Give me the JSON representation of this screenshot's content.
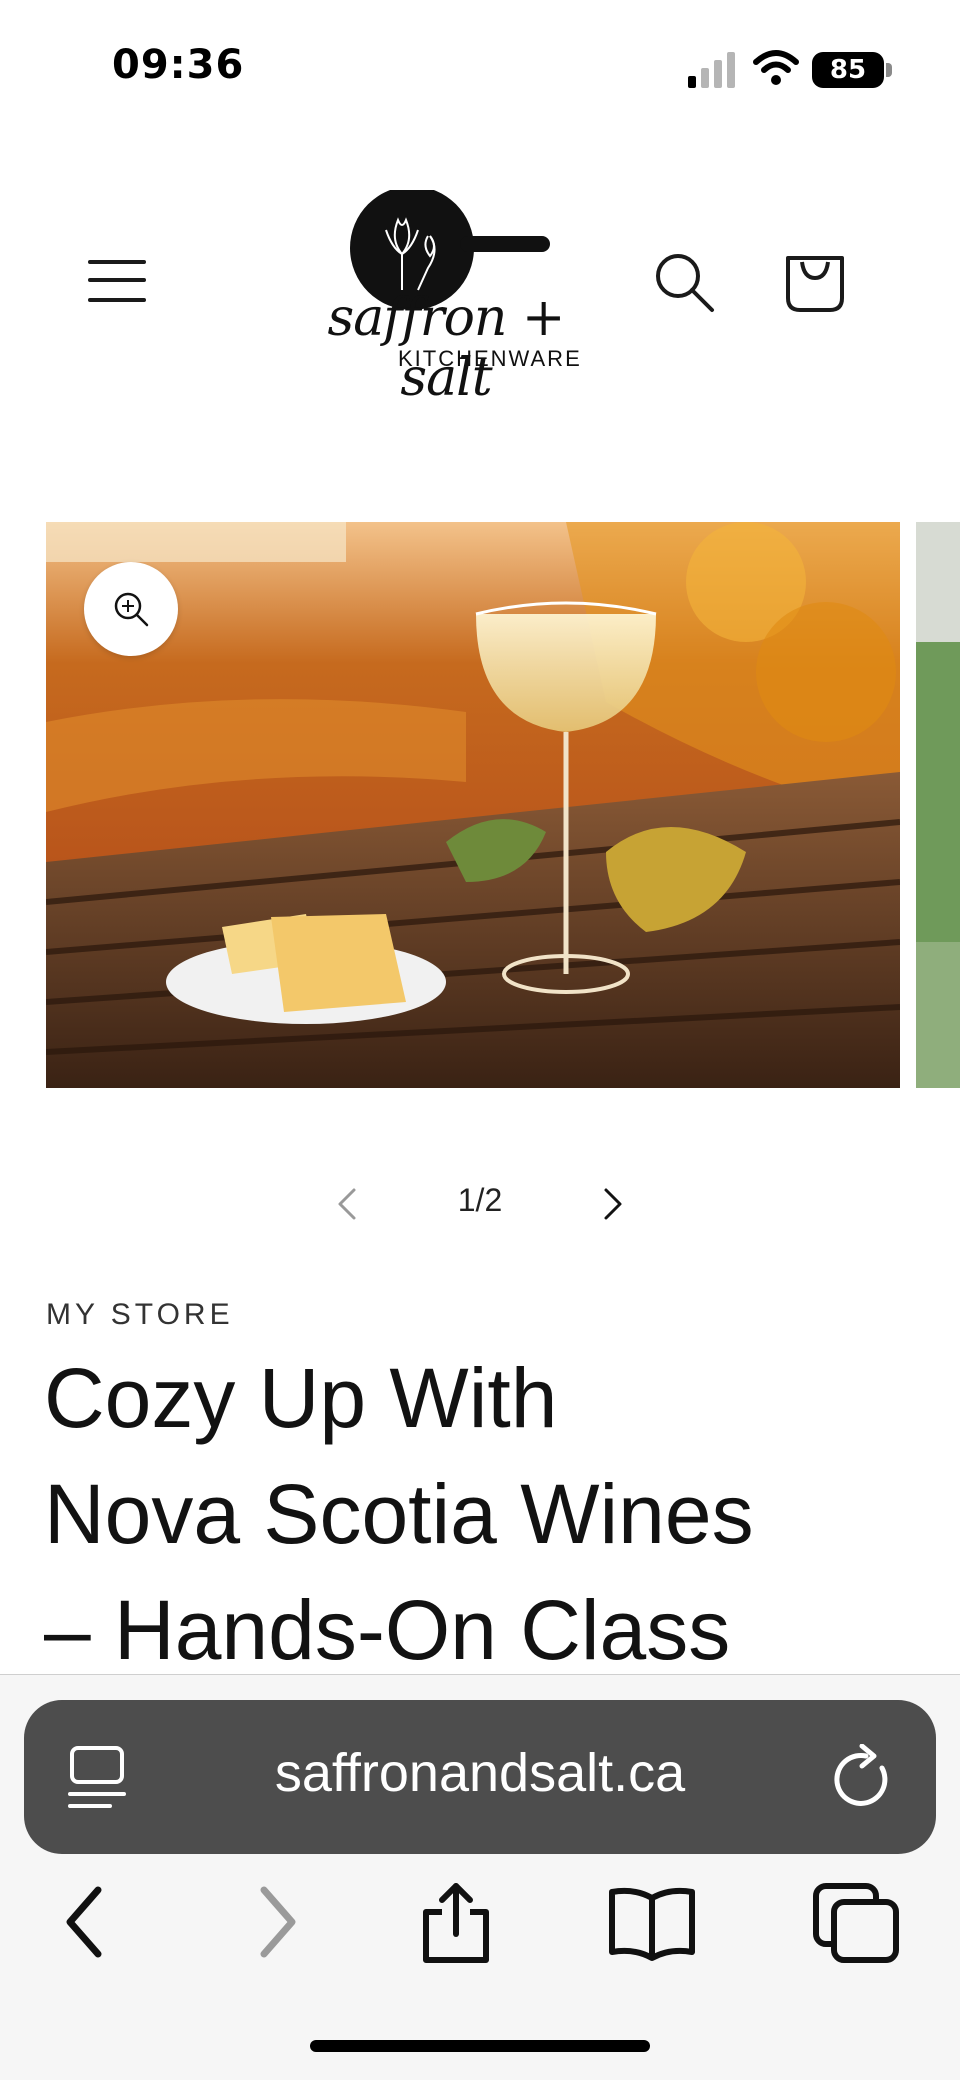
{
  "status_bar": {
    "time": "09:36",
    "battery": "85",
    "icons": [
      "signal-icon",
      "wifi-icon",
      "battery-icon"
    ]
  },
  "header": {
    "logo_script": "saffron + salt",
    "logo_subtitle": "KITCHENWARE",
    "icons": [
      "menu-icon",
      "search-icon",
      "cart-icon"
    ]
  },
  "gallery": {
    "counter": "1/2",
    "icons": [
      "zoom-icon",
      "chevron-left-icon",
      "chevron-right-icon"
    ]
  },
  "product": {
    "vendor": "MY STORE",
    "title_lines": [
      "Cozy Up With",
      "Nova Scotia Wines",
      "– Hands-On Class"
    ]
  },
  "browser": {
    "url": "saffronandsalt.ca",
    "icons": [
      "reader-icon",
      "reload-icon",
      "back-icon",
      "forward-icon",
      "share-icon",
      "bookmarks-icon",
      "tabs-icon"
    ]
  },
  "colors": {
    "accent": "#121212",
    "url_bar": "#4d4d4d",
    "toolbar_bg": "#f6f6f6"
  }
}
